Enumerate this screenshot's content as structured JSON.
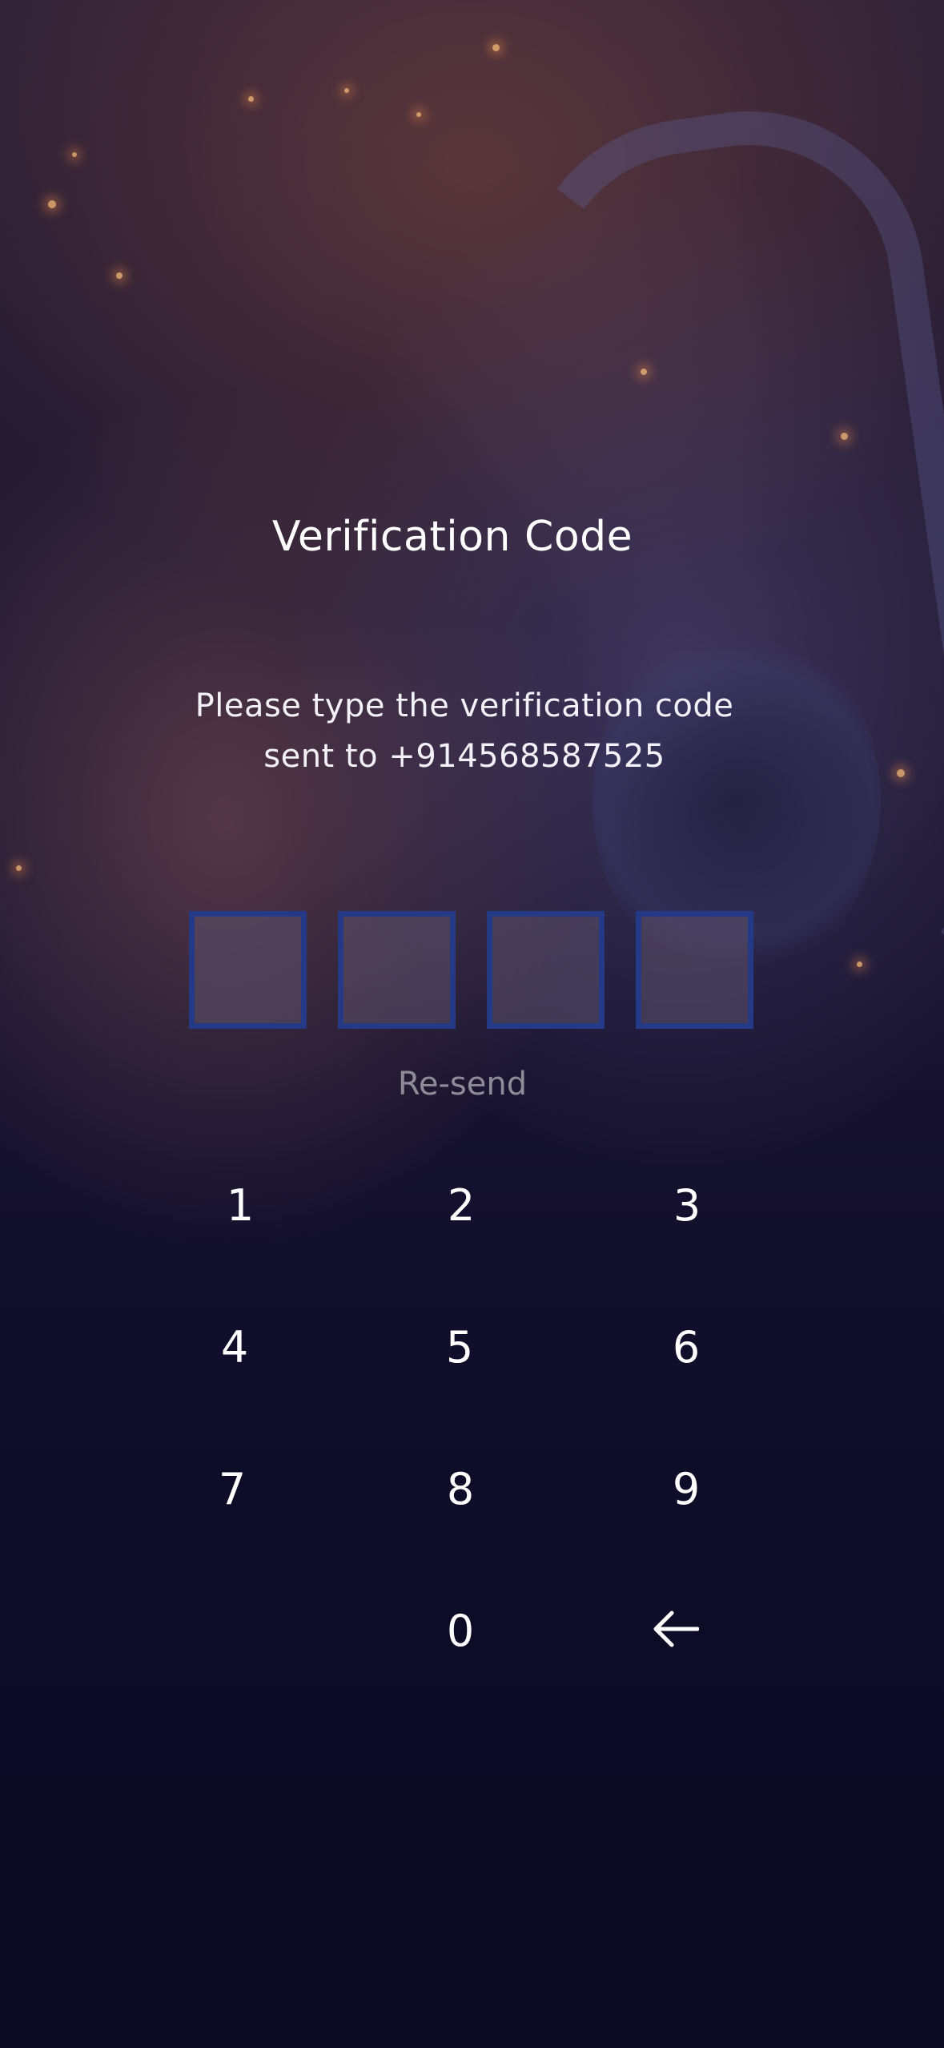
{
  "screen": {
    "title": "Verification Code",
    "instruction": "Please type the verification code sent to +914568587525",
    "resend_label": "Re-send"
  },
  "code": {
    "digits": [
      "",
      "",
      "",
      ""
    ]
  },
  "keypad": {
    "keys": [
      "1",
      "2",
      "3",
      "4",
      "5",
      "6",
      "7",
      "8",
      "9",
      "0"
    ],
    "backspace_icon": "arrow-left-icon"
  },
  "colors": {
    "code_box_border": "#243a86",
    "resend_text": "#8e8b98",
    "background_dark": "#0b0a22"
  }
}
